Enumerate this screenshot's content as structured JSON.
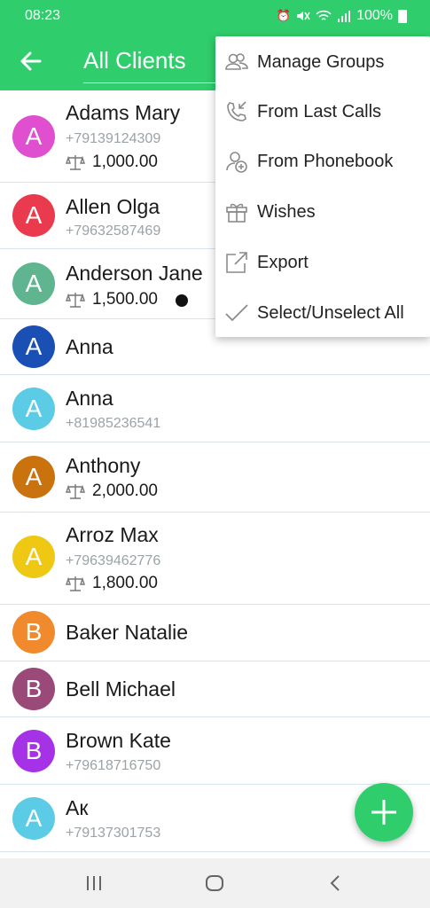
{
  "status_bar": {
    "time": "08:23",
    "battery": "100%"
  },
  "app_bar": {
    "title": "All Clients"
  },
  "clients": [
    {
      "initial": "A",
      "color": "#e04fd0",
      "name": "Adams Mary",
      "phone": "+79139124309",
      "balance": "1,000.00"
    },
    {
      "initial": "A",
      "color": "#ea3b4e",
      "name": "Allen Olga",
      "phone": "+79632587469"
    },
    {
      "initial": "A",
      "color": "#5fb58f",
      "name": "Anderson Jane",
      "balance": "1,500.00",
      "dot": true
    },
    {
      "initial": "A",
      "color": "#1a4fb4",
      "name": "Anna"
    },
    {
      "initial": "A",
      "color": "#5ccbe6",
      "name": "Anna",
      "phone": "+81985236541"
    },
    {
      "initial": "A",
      "color": "#c9720e",
      "name": "Anthony",
      "balance": "2,000.00"
    },
    {
      "initial": "A",
      "color": "#eec812",
      "name": "Arroz Max",
      "phone": "+79639462776",
      "balance": "1,800.00"
    },
    {
      "initial": "B",
      "color": "#f08a2c",
      "name": "Baker Natalie"
    },
    {
      "initial": "B",
      "color": "#9a4a78",
      "name": "Bell Michael"
    },
    {
      "initial": "B",
      "color": "#a632e8",
      "name": "Brown Kate",
      "phone": "+79618716750"
    },
    {
      "initial": "A",
      "color": "#5ccbe6",
      "name": "Ак",
      "phone": "+79137301753"
    }
  ],
  "menu": {
    "items": [
      {
        "label": "Manage Groups",
        "icon": "groups-icon"
      },
      {
        "label": "From Last Calls",
        "icon": "call-import-icon"
      },
      {
        "label": "From Phonebook",
        "icon": "add-contact-icon"
      },
      {
        "label": "Wishes",
        "icon": "gift-icon"
      },
      {
        "label": "Export",
        "icon": "export-icon"
      },
      {
        "label": "Select/Unselect All",
        "icon": "checkmark-icon"
      }
    ]
  },
  "colors": {
    "primary": "#2fcd6b",
    "divider": "#d6e6ec"
  }
}
